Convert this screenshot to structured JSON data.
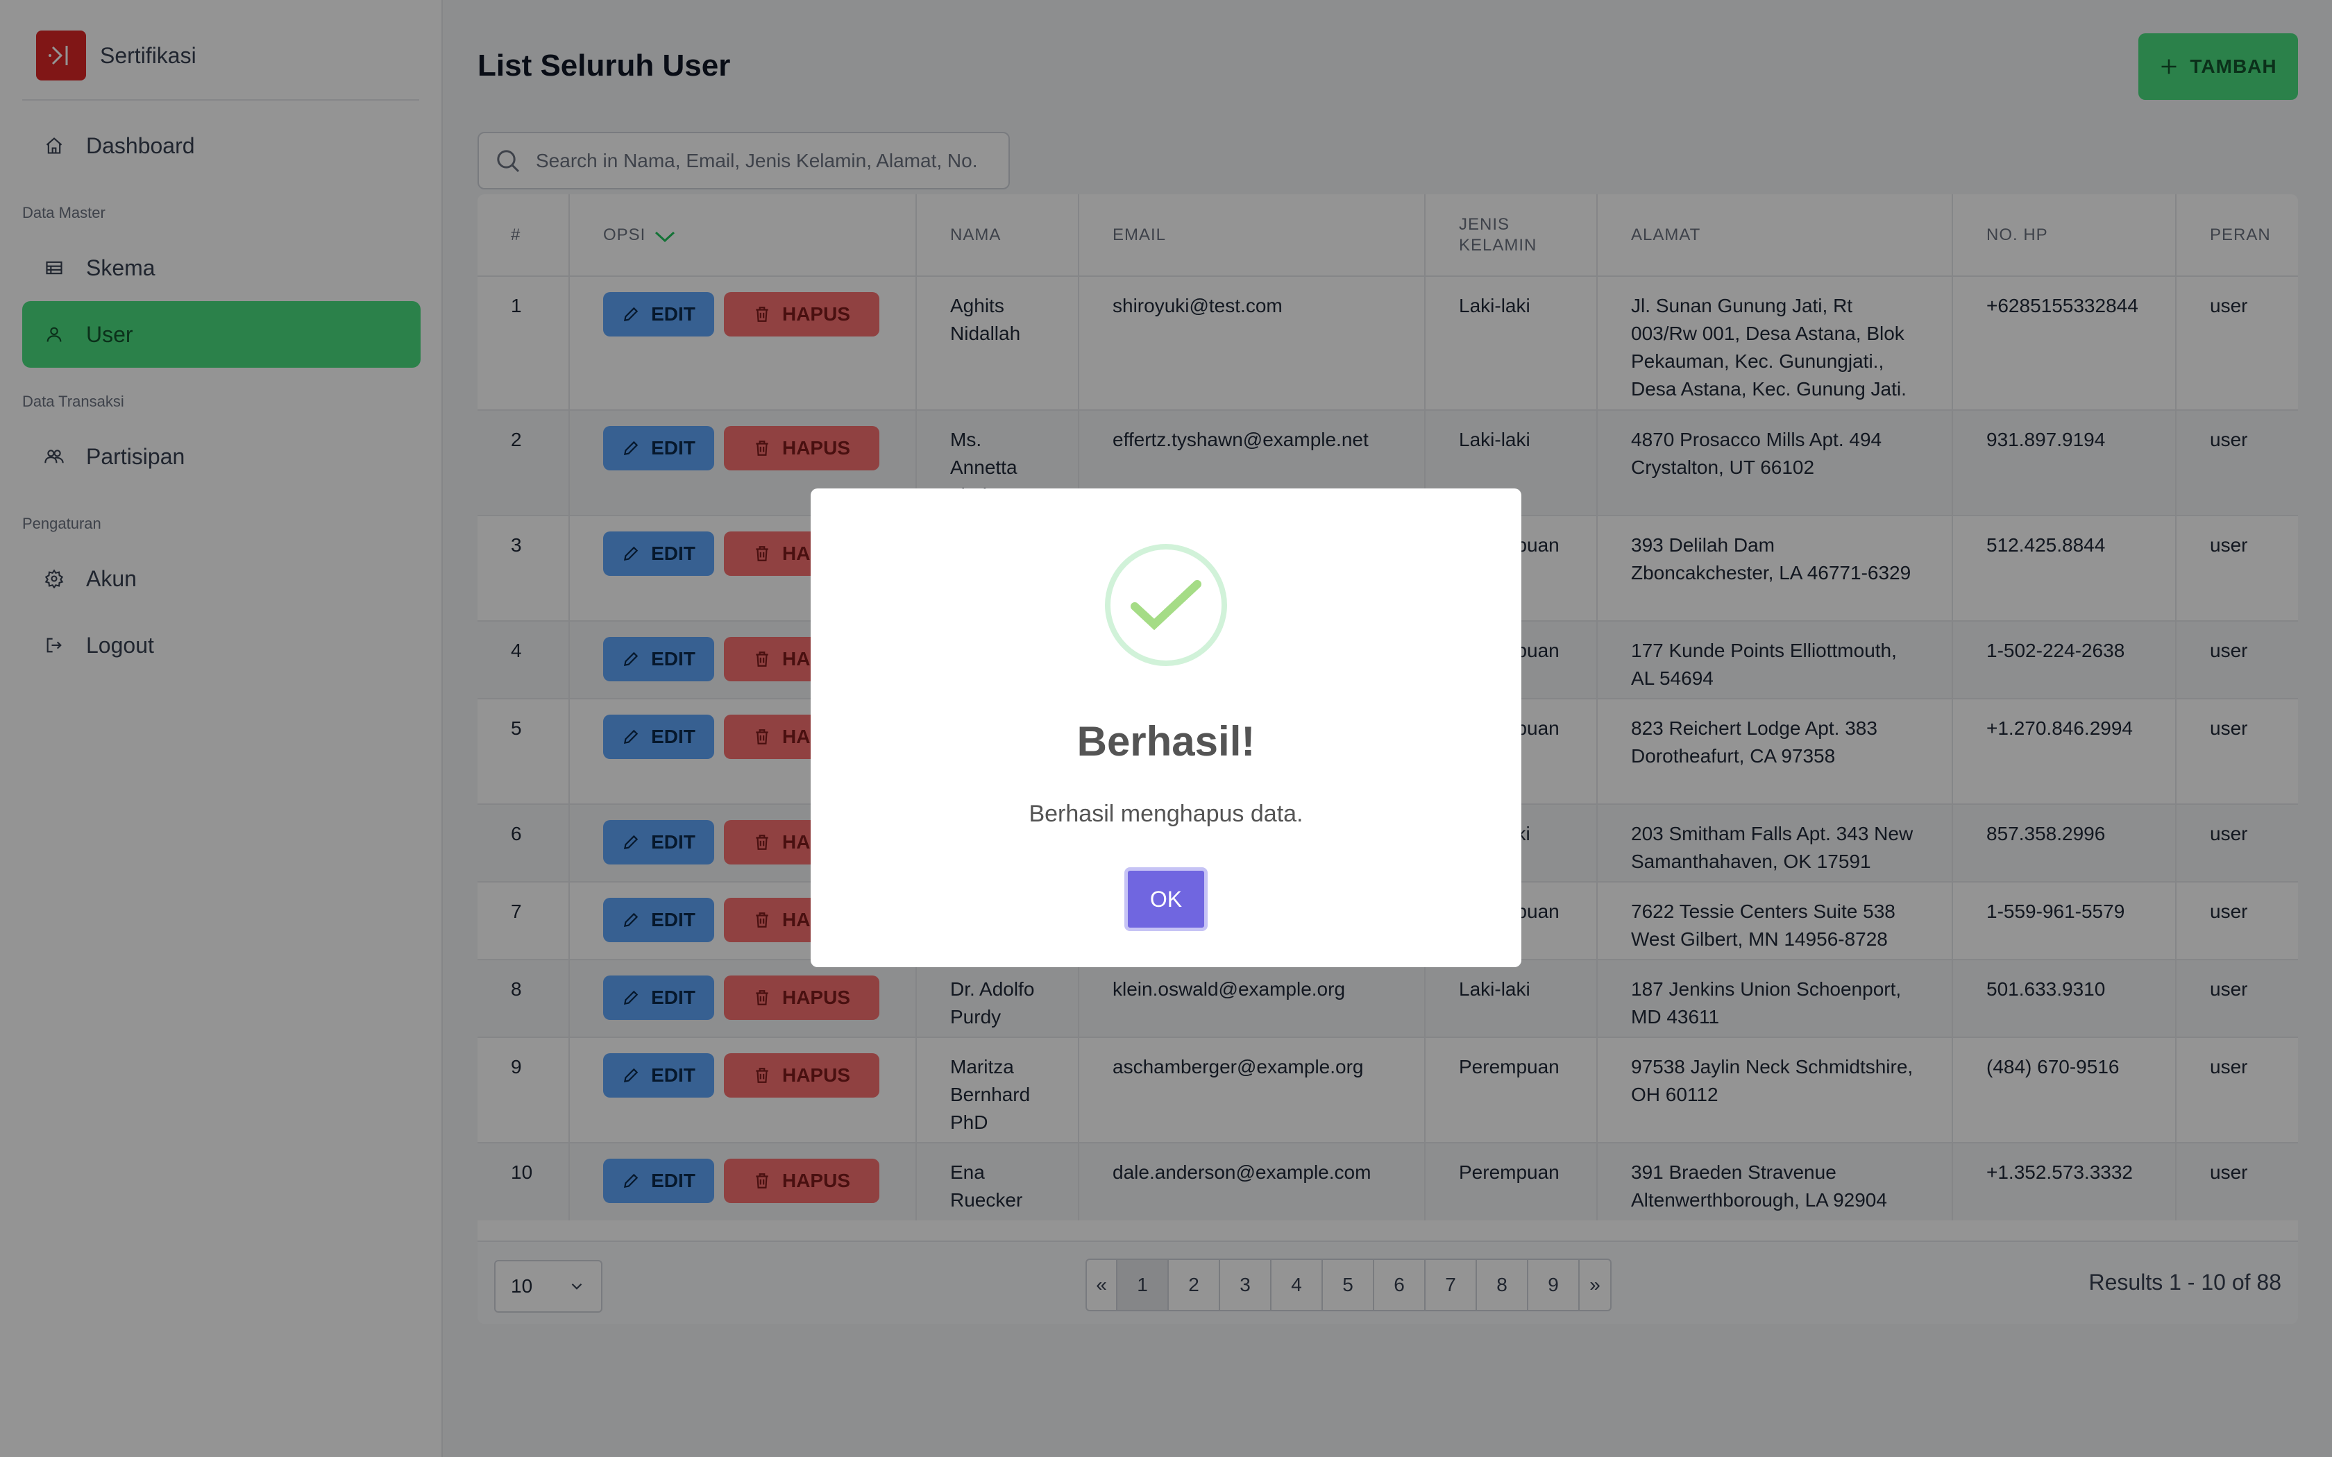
{
  "sidebar": {
    "brand": "Sertifikasi",
    "items": {
      "dashboard": "Dashboard",
      "skema": "Skema",
      "user": "User",
      "partisipan": "Partisipan",
      "akun": "Akun",
      "logout": "Logout"
    },
    "sections": {
      "master": "Data Master",
      "transaksi": "Data Transaksi",
      "pengaturan": "Pengaturan"
    }
  },
  "header": {
    "title": "List Seluruh User",
    "add_label": "TAMBAH"
  },
  "search": {
    "placeholder": "Search in Nama, Email, Jenis Kelamin, Alamat, No. HP"
  },
  "table": {
    "columns": {
      "no": "#",
      "opsi": "OPSI",
      "nama": "NAMA",
      "email": "EMAIL",
      "jenis_kelamin": "JENIS KELAMIN",
      "alamat": "ALAMAT",
      "no_hp": "NO. HP",
      "peran": "PERAN"
    },
    "edit_label": "EDIT",
    "delete_label": "HAPUS",
    "rows": [
      {
        "no": "1",
        "nama": "Aghits Nidallah",
        "email": "shiroyuki@test.com",
        "jk": "Laki-laki",
        "alamat": "Jl. Sunan Gunung Jati, Rt 003/Rw 001, Desa Astana, Blok Pekauman, Kec. Gunungjati., Desa Astana, Kec. Gunung Jati.",
        "hp": "+6285155332844",
        "peran": "user"
      },
      {
        "no": "2",
        "nama": "Ms. Annetta Lind",
        "email": "effertz.tyshawn@example.net",
        "jk": "Laki-laki",
        "alamat": "4870 Prosacco Mills Apt. 494 Crystalton, UT 66102",
        "hp": "931.897.9194",
        "peran": "user"
      },
      {
        "no": "3",
        "nama": "",
        "email": "",
        "jk": "Perempuan",
        "alamat": "393 Delilah Dam Zboncakchester, LA 46771-6329",
        "hp": "512.425.8844",
        "peran": "user"
      },
      {
        "no": "4",
        "nama": "",
        "email": "",
        "jk": "Perempuan",
        "alamat": "177 Kunde Points Elliottmouth, AL 54694",
        "hp": "1-502-224-2638",
        "peran": "user"
      },
      {
        "no": "5",
        "nama": "",
        "email": "",
        "jk": "Perempuan",
        "alamat": "823 Reichert Lodge Apt. 383 Dorotheafurt, CA 97358",
        "hp": "+1.270.846.2994",
        "peran": "user"
      },
      {
        "no": "6",
        "nama": "",
        "email": "",
        "jk": "Laki-laki",
        "alamat": "203 Smitham Falls Apt. 343 New Samanthahaven, OK 17591",
        "hp": "857.358.2996",
        "peran": "user"
      },
      {
        "no": "7",
        "nama": "",
        "email": "",
        "jk": "Perempuan",
        "alamat": "7622 Tessie Centers Suite 538 West Gilbert, MN 14956-8728",
        "hp": "1-559-961-5579",
        "peran": "user"
      },
      {
        "no": "8",
        "nama": "Dr. Adolfo Purdy",
        "email": "klein.oswald@example.org",
        "jk": "Laki-laki",
        "alamat": "187 Jenkins Union Schoenport, MD 43611",
        "hp": "501.633.9310",
        "peran": "user"
      },
      {
        "no": "9",
        "nama": "Maritza Bernhard PhD",
        "email": "aschamberger@example.org",
        "jk": "Perempuan",
        "alamat": "97538 Jaylin Neck Schmidtshire, OH 60112",
        "hp": "(484) 670-9516",
        "peran": "user"
      },
      {
        "no": "10",
        "nama": "Ena Ruecker",
        "email": "dale.anderson@example.com",
        "jk": "Perempuan",
        "alamat": "391 Braeden Stravenue Altenwerthborough, LA 92904",
        "hp": "+1.352.573.3332",
        "peran": "user"
      }
    ]
  },
  "footer": {
    "per_page": "10",
    "pages": [
      "1",
      "2",
      "3",
      "4",
      "5",
      "6",
      "7",
      "8",
      "9"
    ],
    "prev": "«",
    "next": "»",
    "results": "Results 1 - 10 of 88"
  },
  "modal": {
    "title": "Berhasil!",
    "text": "Berhasil menghapus data.",
    "ok_label": "OK"
  }
}
